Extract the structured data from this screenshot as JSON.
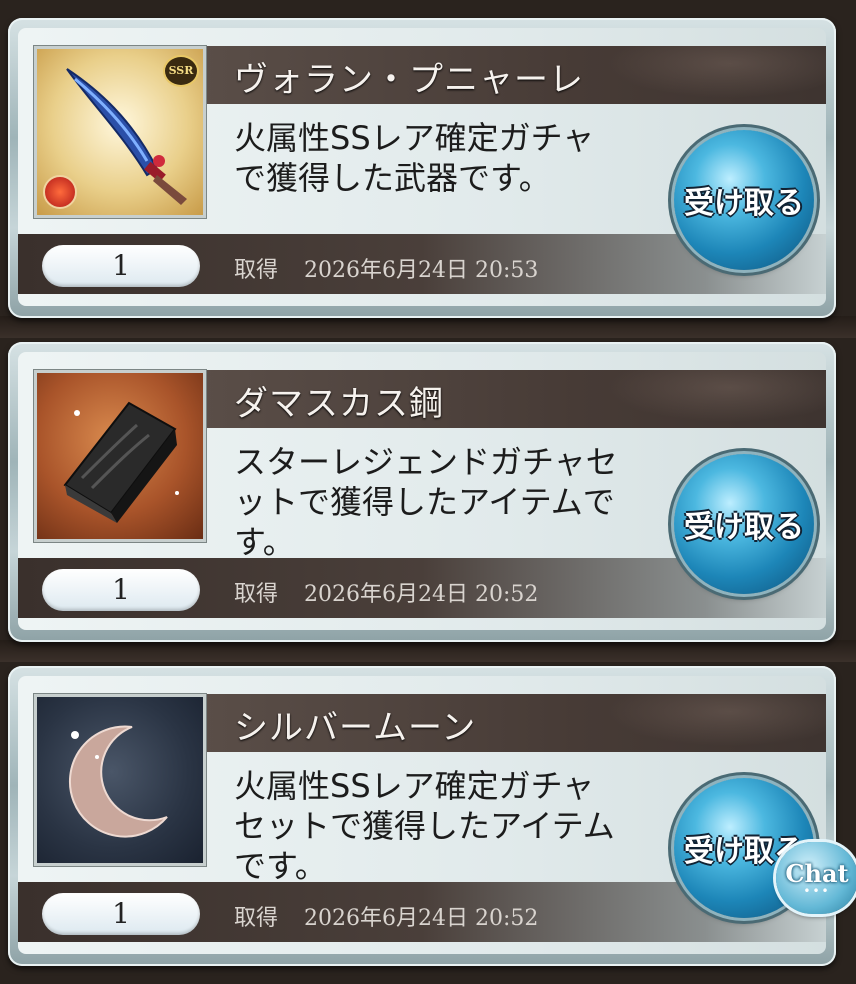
{
  "items": [
    {
      "name": "ヴォラン・プニャーレ",
      "description_lines": [
        "火属性SSレア確定ガチャ",
        "で獲得した武器です。"
      ],
      "quantity": "1",
      "obtained_label": "取得",
      "obtained_datetime": "2026年6月24日 20:53",
      "receive_label": "受け取る",
      "icon": "weapon-dagger-icon",
      "badge": "SSR"
    },
    {
      "name": "ダマスカス鋼",
      "description_lines": [
        "スターレジェンドガチャセ",
        "ットで獲得したアイテムで",
        "す。"
      ],
      "quantity": "1",
      "obtained_label": "取得",
      "obtained_datetime": "2026年6月24日 20:52",
      "receive_label": "受け取る",
      "icon": "damascus-ingot-icon"
    },
    {
      "name": "シルバームーン",
      "description_lines": [
        "火属性SSレア確定ガチャ",
        "セットで獲得したアイテム",
        "です。"
      ],
      "quantity": "1",
      "obtained_label": "取得",
      "obtained_datetime": "2026年6月24日 20:52",
      "receive_label": "受け取る",
      "icon": "silver-moon-icon"
    }
  ],
  "chat": {
    "label": "Chat",
    "dots": "•••"
  }
}
